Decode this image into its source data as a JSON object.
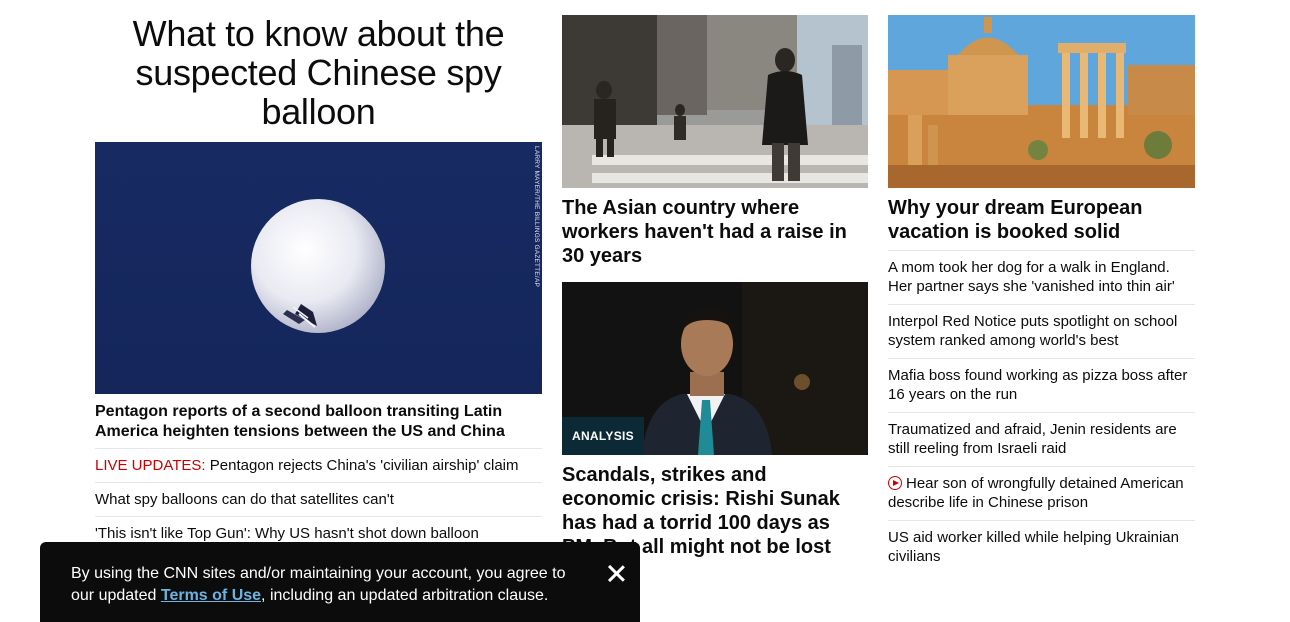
{
  "col1": {
    "headline": "What to know about the suspected Chinese spy balloon",
    "hero_credit": "LARRY MAYER/THE BILLINGS GAZETTE/AP",
    "hero_caption": "Pentagon reports of a second balloon transiting Latin America heighten tensions between the US and China",
    "list": [
      {
        "prefix": "LIVE UPDATES:",
        "text": " Pentagon rejects China's 'civilian airship' claim"
      },
      {
        "prefix": "",
        "text": "What spy balloons can do that satellites can't"
      },
      {
        "prefix": "",
        "text": "'This isn't like Top Gun': Why US hasn't shot down balloon"
      }
    ]
  },
  "col2": {
    "card1_headline": "The Asian country where workers haven't had a raise in 30 years",
    "badge": "ANALYSIS",
    "card2_headline": "Scandals, strikes and economic crisis: Rishi Sunak has had a torrid 100 days as PM. But all might not be lost"
  },
  "col3": {
    "card_headline": "Why your dream European vacation is booked solid",
    "list": [
      "A mom took her dog for a walk in England. Her partner says she 'vanished into thin air'",
      "Interpol Red Notice puts spotlight on school system ranked among world's best",
      "Mafia boss found working as pizza boss after 16 years on the run",
      "Traumatized and afraid, Jenin residents are still reeling from Israeli raid",
      "Hear son of wrongfully detained American describe life in Chinese prison",
      "US aid worker killed while helping Ukrainian civilians"
    ],
    "video_item_icon": "play-circle-icon"
  },
  "banner": {
    "text_before": "By using the CNN sites and/or maintaining your account, you agree to our updated ",
    "link": "Terms of Use",
    "text_after": ", including an updated arbitration clause.",
    "close_icon": "close-icon"
  },
  "colors": {
    "live_red": "#cc0000",
    "link_blue": "#6bb3e0",
    "balloon_sky": "#15265c"
  }
}
